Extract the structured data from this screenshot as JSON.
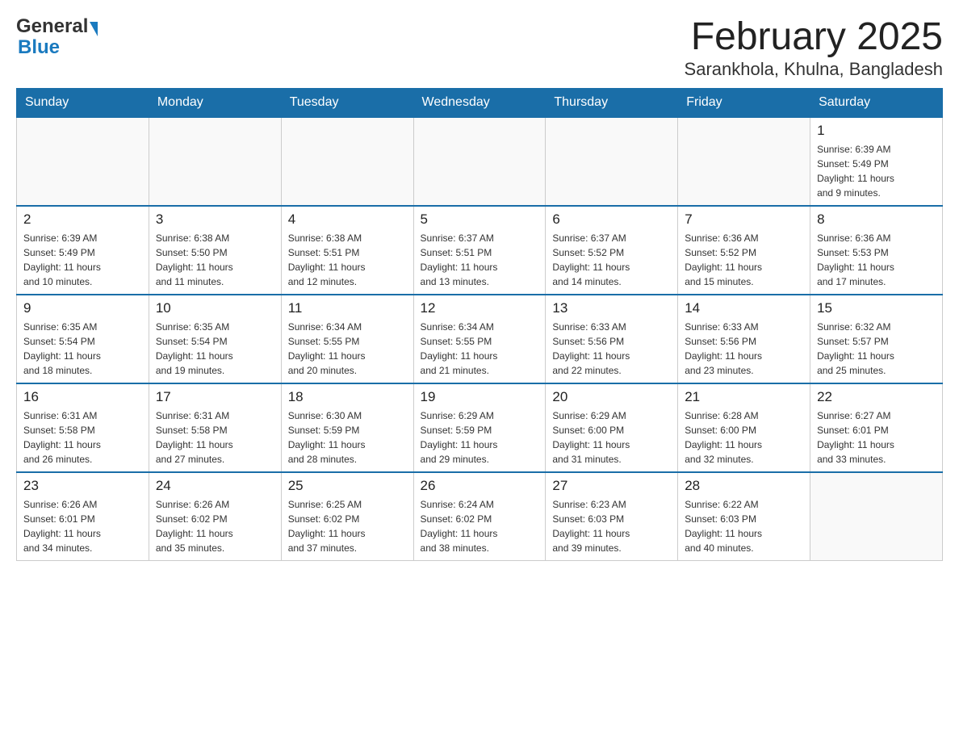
{
  "logo": {
    "text_general": "General",
    "text_blue": "Blue",
    "aria": "GeneralBlue logo"
  },
  "header": {
    "month_year": "February 2025",
    "location": "Sarankhola, Khulna, Bangladesh"
  },
  "days_of_week": [
    "Sunday",
    "Monday",
    "Tuesday",
    "Wednesday",
    "Thursday",
    "Friday",
    "Saturday"
  ],
  "weeks": [
    {
      "days": [
        {
          "number": "",
          "info": ""
        },
        {
          "number": "",
          "info": ""
        },
        {
          "number": "",
          "info": ""
        },
        {
          "number": "",
          "info": ""
        },
        {
          "number": "",
          "info": ""
        },
        {
          "number": "",
          "info": ""
        },
        {
          "number": "1",
          "info": "Sunrise: 6:39 AM\nSunset: 5:49 PM\nDaylight: 11 hours\nand 9 minutes."
        }
      ]
    },
    {
      "days": [
        {
          "number": "2",
          "info": "Sunrise: 6:39 AM\nSunset: 5:49 PM\nDaylight: 11 hours\nand 10 minutes."
        },
        {
          "number": "3",
          "info": "Sunrise: 6:38 AM\nSunset: 5:50 PM\nDaylight: 11 hours\nand 11 minutes."
        },
        {
          "number": "4",
          "info": "Sunrise: 6:38 AM\nSunset: 5:51 PM\nDaylight: 11 hours\nand 12 minutes."
        },
        {
          "number": "5",
          "info": "Sunrise: 6:37 AM\nSunset: 5:51 PM\nDaylight: 11 hours\nand 13 minutes."
        },
        {
          "number": "6",
          "info": "Sunrise: 6:37 AM\nSunset: 5:52 PM\nDaylight: 11 hours\nand 14 minutes."
        },
        {
          "number": "7",
          "info": "Sunrise: 6:36 AM\nSunset: 5:52 PM\nDaylight: 11 hours\nand 15 minutes."
        },
        {
          "number": "8",
          "info": "Sunrise: 6:36 AM\nSunset: 5:53 PM\nDaylight: 11 hours\nand 17 minutes."
        }
      ]
    },
    {
      "days": [
        {
          "number": "9",
          "info": "Sunrise: 6:35 AM\nSunset: 5:54 PM\nDaylight: 11 hours\nand 18 minutes."
        },
        {
          "number": "10",
          "info": "Sunrise: 6:35 AM\nSunset: 5:54 PM\nDaylight: 11 hours\nand 19 minutes."
        },
        {
          "number": "11",
          "info": "Sunrise: 6:34 AM\nSunset: 5:55 PM\nDaylight: 11 hours\nand 20 minutes."
        },
        {
          "number": "12",
          "info": "Sunrise: 6:34 AM\nSunset: 5:55 PM\nDaylight: 11 hours\nand 21 minutes."
        },
        {
          "number": "13",
          "info": "Sunrise: 6:33 AM\nSunset: 5:56 PM\nDaylight: 11 hours\nand 22 minutes."
        },
        {
          "number": "14",
          "info": "Sunrise: 6:33 AM\nSunset: 5:56 PM\nDaylight: 11 hours\nand 23 minutes."
        },
        {
          "number": "15",
          "info": "Sunrise: 6:32 AM\nSunset: 5:57 PM\nDaylight: 11 hours\nand 25 minutes."
        }
      ]
    },
    {
      "days": [
        {
          "number": "16",
          "info": "Sunrise: 6:31 AM\nSunset: 5:58 PM\nDaylight: 11 hours\nand 26 minutes."
        },
        {
          "number": "17",
          "info": "Sunrise: 6:31 AM\nSunset: 5:58 PM\nDaylight: 11 hours\nand 27 minutes."
        },
        {
          "number": "18",
          "info": "Sunrise: 6:30 AM\nSunset: 5:59 PM\nDaylight: 11 hours\nand 28 minutes."
        },
        {
          "number": "19",
          "info": "Sunrise: 6:29 AM\nSunset: 5:59 PM\nDaylight: 11 hours\nand 29 minutes."
        },
        {
          "number": "20",
          "info": "Sunrise: 6:29 AM\nSunset: 6:00 PM\nDaylight: 11 hours\nand 31 minutes."
        },
        {
          "number": "21",
          "info": "Sunrise: 6:28 AM\nSunset: 6:00 PM\nDaylight: 11 hours\nand 32 minutes."
        },
        {
          "number": "22",
          "info": "Sunrise: 6:27 AM\nSunset: 6:01 PM\nDaylight: 11 hours\nand 33 minutes."
        }
      ]
    },
    {
      "days": [
        {
          "number": "23",
          "info": "Sunrise: 6:26 AM\nSunset: 6:01 PM\nDaylight: 11 hours\nand 34 minutes."
        },
        {
          "number": "24",
          "info": "Sunrise: 6:26 AM\nSunset: 6:02 PM\nDaylight: 11 hours\nand 35 minutes."
        },
        {
          "number": "25",
          "info": "Sunrise: 6:25 AM\nSunset: 6:02 PM\nDaylight: 11 hours\nand 37 minutes."
        },
        {
          "number": "26",
          "info": "Sunrise: 6:24 AM\nSunset: 6:02 PM\nDaylight: 11 hours\nand 38 minutes."
        },
        {
          "number": "27",
          "info": "Sunrise: 6:23 AM\nSunset: 6:03 PM\nDaylight: 11 hours\nand 39 minutes."
        },
        {
          "number": "28",
          "info": "Sunrise: 6:22 AM\nSunset: 6:03 PM\nDaylight: 11 hours\nand 40 minutes."
        },
        {
          "number": "",
          "info": ""
        }
      ]
    }
  ]
}
